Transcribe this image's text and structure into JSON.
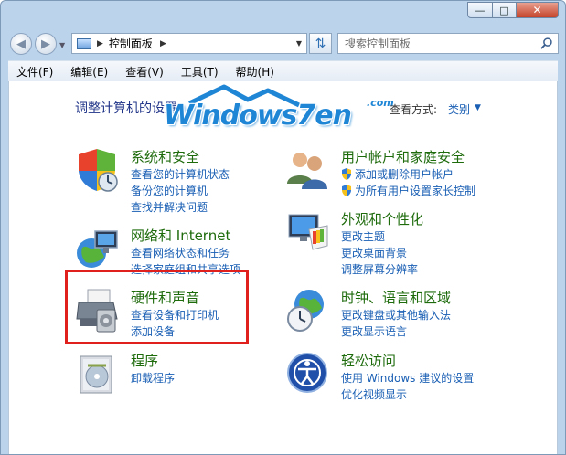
{
  "address": {
    "path_label": "控制面板"
  },
  "search": {
    "placeholder": "搜索控制面板"
  },
  "menu": [
    {
      "label": "文件(F)"
    },
    {
      "label": "编辑(E)"
    },
    {
      "label": "查看(V)"
    },
    {
      "label": "工具(T)"
    },
    {
      "label": "帮助(H)"
    }
  ],
  "content": {
    "heading": "调整计算机的设置",
    "view_by_label": "查看方式:",
    "view_by_value": "类别"
  },
  "logo": {
    "text": "Windows7en",
    "suffix": ".com"
  },
  "categories": [
    {
      "title": "系统和安全",
      "links": [
        "查看您的计算机状态",
        "备份您的计算机",
        "查找并解决问题"
      ],
      "icon": "shield-icon"
    },
    {
      "title": "网络和 Internet",
      "links": [
        "查看网络状态和任务",
        "选择家庭组和共享选项"
      ],
      "icon": "network-globe-icon"
    },
    {
      "title": "硬件和声音",
      "links": [
        "查看设备和打印机",
        "添加设备"
      ],
      "icon": "printer-icon"
    },
    {
      "title": "程序",
      "links": [
        "卸载程序"
      ],
      "icon": "programs-disc-icon"
    },
    {
      "title": "用户帐户和家庭安全",
      "links": [
        "添加或删除用户帐户",
        "为所有用户设置家长控制"
      ],
      "icon": "users-icon"
    },
    {
      "title": "外观和个性化",
      "links": [
        "更改主题",
        "更改桌面背景",
        "调整屏幕分辨率"
      ],
      "icon": "monitor-palette-icon"
    },
    {
      "title": "时钟、语言和区域",
      "links": [
        "更改键盘或其他输入法",
        "更改显示语言"
      ],
      "icon": "clock-globe-icon"
    },
    {
      "title": "轻松访问",
      "links": [
        "使用 Windows 建议的设置",
        "优化视频显示"
      ],
      "icon": "ease-of-access-icon"
    }
  ],
  "colors": {
    "category_title": "#1e6b0c",
    "link": "#1a5fb4",
    "highlight_border": "#e0201d",
    "heading": "#1e3287"
  }
}
